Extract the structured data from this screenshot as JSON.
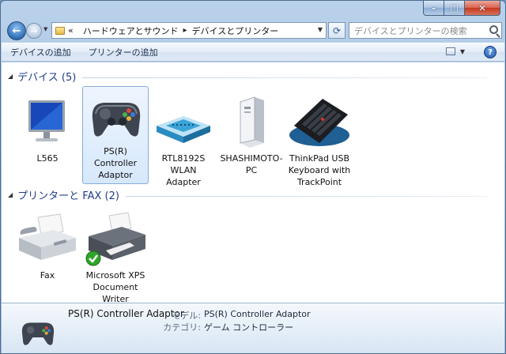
{
  "window": {
    "caption_min": "–",
    "caption_max": "□",
    "caption_close": "✕"
  },
  "address": {
    "history_glyph": "«",
    "crumbs": [
      "ハードウェアとサウンド",
      "デバイスとプリンター"
    ],
    "separator": "▸"
  },
  "search": {
    "placeholder": "デバイスとプリンターの検索"
  },
  "commands": [
    "デバイスの追加",
    "プリンターの追加"
  ],
  "groups": [
    {
      "title": "デバイス (5)",
      "items": [
        {
          "label": "L565",
          "icon": "monitor-icon"
        },
        {
          "label": "PS(R) Controller Adaptor",
          "icon": "gamepad-icon",
          "selected": true
        },
        {
          "label": "RTL8192S WLAN Adapter",
          "icon": "wlan-adapter-icon"
        },
        {
          "label": "SHASHIMOTO-PC",
          "icon": "computer-tower-icon"
        },
        {
          "label": "ThinkPad USB Keyboard with TrackPoint",
          "icon": "keyboard-icon"
        }
      ]
    },
    {
      "title": "プリンターと FAX (2)",
      "items": [
        {
          "label": "Fax",
          "icon": "fax-icon"
        },
        {
          "label": "Microsoft XPS Document Writer",
          "icon": "printer-icon",
          "default_badge": true
        }
      ]
    }
  ],
  "details": {
    "name": "PS(R) Controller Adaptor",
    "model_label": "モデル:",
    "model_value": "PS(R) Controller Adaptor",
    "category_label": "カテゴリ:",
    "category_value": "ゲーム コントローラー"
  },
  "colors": {
    "accent_title": "#1e3d87",
    "selection_border": "#84acdd",
    "default_check": "#2fa52b"
  }
}
